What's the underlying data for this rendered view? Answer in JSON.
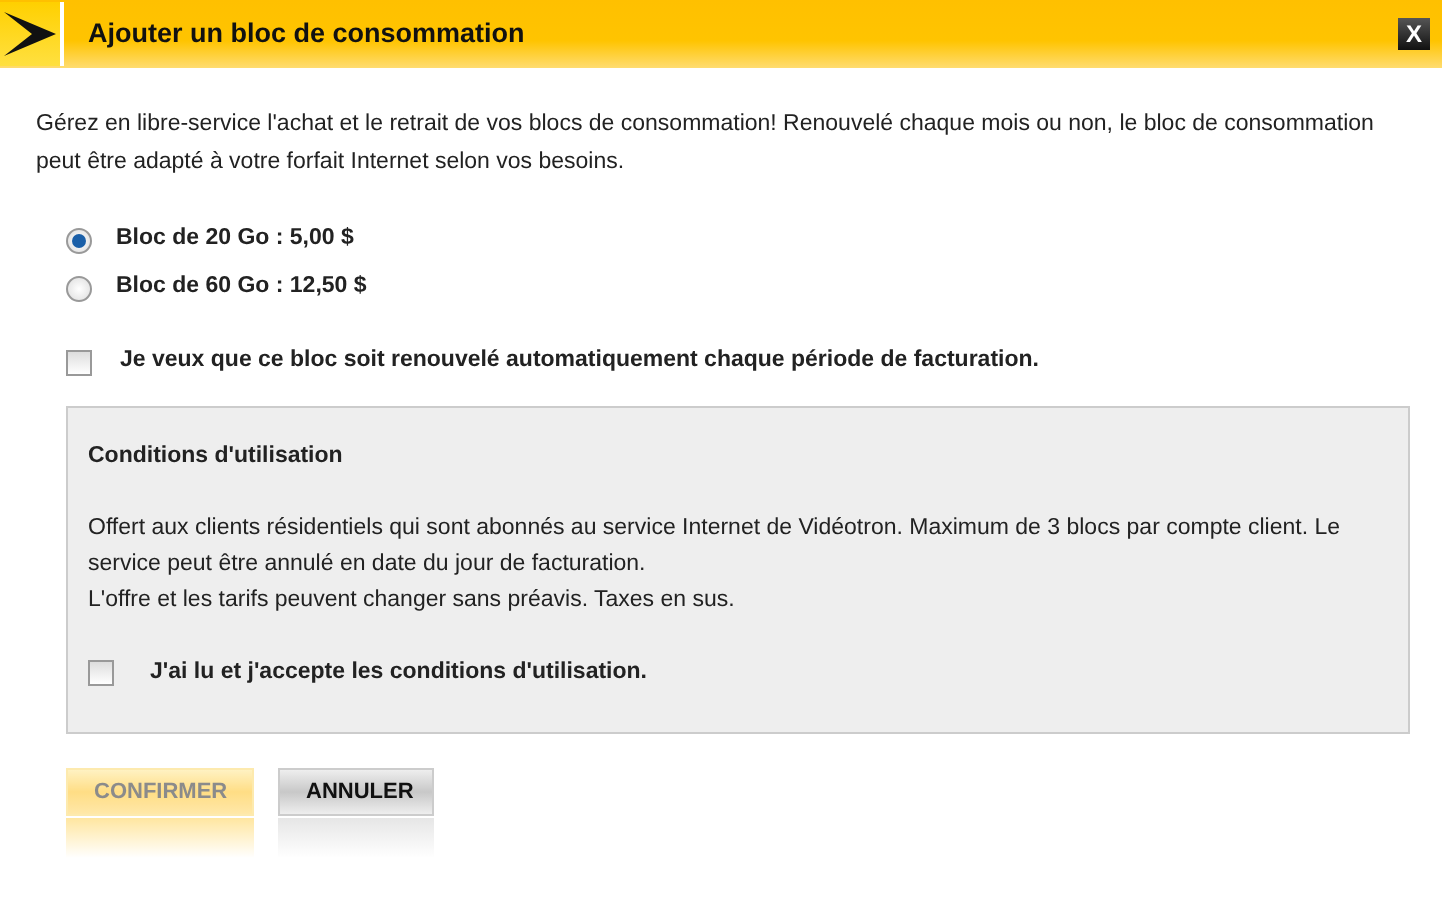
{
  "window": {
    "title": "Ajouter un bloc de consommation",
    "close": "X"
  },
  "intro": "Gérez en libre-service l'achat et le retrait de vos blocs de consommation! Renouvelé chaque mois ou non, le bloc de consommation peut être adapté à votre forfait Internet selon vos besoins.",
  "options": [
    {
      "label": "Bloc de 20 Go : 5,00 $",
      "selected": true
    },
    {
      "label": "Bloc de 60 Go : 12,50 $",
      "selected": false
    }
  ],
  "renew": {
    "label": "Je veux que ce bloc soit renouvelé automatiquement chaque période de facturation.",
    "checked": false
  },
  "conditions": {
    "title": "Conditions d'utilisation",
    "lines": [
      "Offert aux clients résidentiels qui sont abonnés au service Internet de Vidéotron. Maximum de 3 blocs par compte client. Le service peut être annulé en date du jour de facturation.",
      "L'offre et les tarifs peuvent changer sans préavis. Taxes en sus."
    ],
    "accept": {
      "label": "J'ai lu et j'accepte les conditions d'utilisation.",
      "checked": false
    }
  },
  "buttons": [
    {
      "label": "CONFIRMER",
      "kind": "primary",
      "disabled": true
    },
    {
      "label": "ANNULER",
      "kind": "secondary",
      "disabled": false
    }
  ]
}
